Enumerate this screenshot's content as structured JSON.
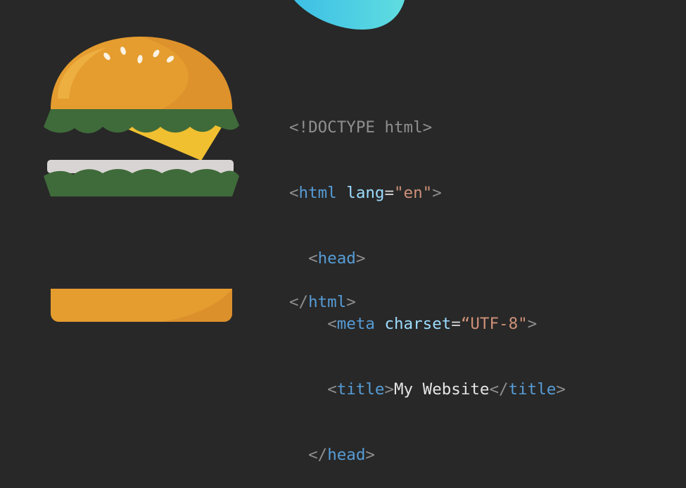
{
  "code": {
    "doctype": "<!DOCTYPE html>",
    "html_open_bracket": "<",
    "html_tag": "html",
    "lang_attr": "lang",
    "lang_eq": "=",
    "lang_value": "\"en\"",
    "html_open_end": ">",
    "head_open_bracket": "<",
    "head_tag": "head",
    "head_open_end": ">",
    "meta_open_bracket": "<",
    "meta_tag": "meta",
    "charset_attr": "charset",
    "charset_eq": "=",
    "charset_value": "“UTF-8\"",
    "meta_end": ">",
    "title_open_bracket": "<",
    "title_tag": "title",
    "title_open_end": ">",
    "title_text": "My Website",
    "title_close_bracket": "</",
    "title_close_tag": "title",
    "title_close_end": ">",
    "head_close_bracket": "</",
    "head_close_tag": "head",
    "head_close_end": ">",
    "html_close_bracket": "</",
    "html_close_tag": "html",
    "html_close_end": ">"
  },
  "colors": {
    "background": "#282828",
    "bun": "#e59d2f",
    "lettuce": "#3f6b3a",
    "cheese": "#f0c030",
    "patty_plate": "#d9d4d4",
    "blob": "#4dd4e0"
  }
}
